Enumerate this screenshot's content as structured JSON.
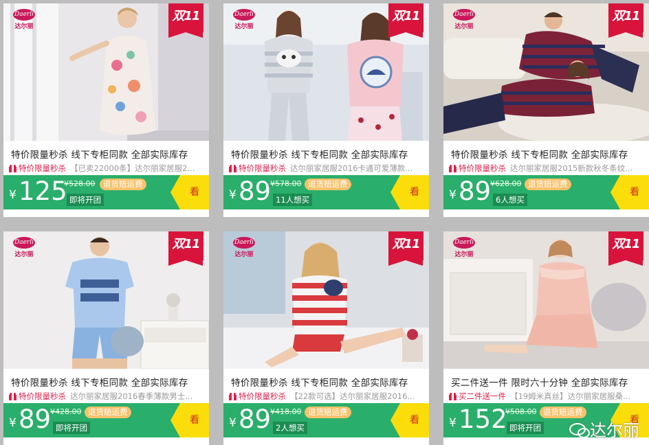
{
  "products": [
    {
      "brand": "达尔丽",
      "brand_logo": "Daerli",
      "badge": "双11",
      "sell_line": "特价限量秒杀  线下专柜同款  全部实际库存",
      "tag": "特价限量秒杀",
      "desc": "【已卖22000条】达尔丽家居服2...",
      "price": "125",
      "orig_price": "¥528.00",
      "refund_label": "退货赔运费",
      "status": "即将开团",
      "look": "看"
    },
    {
      "brand": "达尔丽",
      "brand_logo": "Daerli",
      "badge": "双11",
      "sell_line": "特价限量秒杀  线下专柜同款  全部实际库存",
      "tag": "特价限量秒杀",
      "desc": "达尔丽家居服2016卡通可爱薄款...",
      "price": "89",
      "orig_price": "¥578.00",
      "refund_label": "退货赔运费",
      "status": "11人想买",
      "look": "看"
    },
    {
      "brand": "达尔丽",
      "brand_logo": "Daerli",
      "badge": "双11",
      "sell_line": "特价限量秒杀  线下专柜同款  全部实际库存",
      "tag": "特价限量秒杀",
      "desc": "达尔丽家居服2015新款秋冬条纹...",
      "price": "89",
      "orig_price": "¥628.00",
      "refund_label": "退货赔运费",
      "status": "6人想买",
      "look": "看"
    },
    {
      "brand": "达尔丽",
      "brand_logo": "Daerli",
      "badge": "双11",
      "sell_line": "特价限量秒杀  线下专柜同款  全部实际库存",
      "tag": "特价限量秒杀",
      "desc": "达尔丽家居服2016春季薄款男士...",
      "price": "89",
      "orig_price": "¥428.00",
      "refund_label": "退货赔运费",
      "status": "即将开团",
      "look": "看"
    },
    {
      "brand": "达尔丽",
      "brand_logo": "Daerli",
      "badge": "双11",
      "sell_line": "特价限量秒杀  线下专柜同款  全部实际库存",
      "tag": "特价限量秒杀",
      "desc": "【22款可选】达尔丽家居服2016...",
      "price": "89",
      "orig_price": "¥418.00",
      "refund_label": "退货赔运费",
      "status": "2人想买",
      "look": "看"
    },
    {
      "brand": "达尔丽",
      "brand_logo": "Daerli",
      "badge": "双11",
      "sell_line": "买二件送一件  限时六十分钟  全部实际库存",
      "tag": "买二件送一件",
      "desc": "【19姆米真丝】达尔丽家居服桑...",
      "price": "152",
      "orig_price": "¥508.00",
      "refund_label": "退货赔运费",
      "status": "即将开团",
      "look": "看"
    }
  ],
  "currency_symbol": "¥",
  "watermark": "达尔丽",
  "colors": {
    "price_bar": "#2aae6b",
    "look_button": "#fadd0a",
    "badge": "#d8143c",
    "tag_red": "#e1204a",
    "refund_pill": "#f6c26b"
  },
  "icons": [
    "gift-icon",
    "wechat-icon"
  ]
}
